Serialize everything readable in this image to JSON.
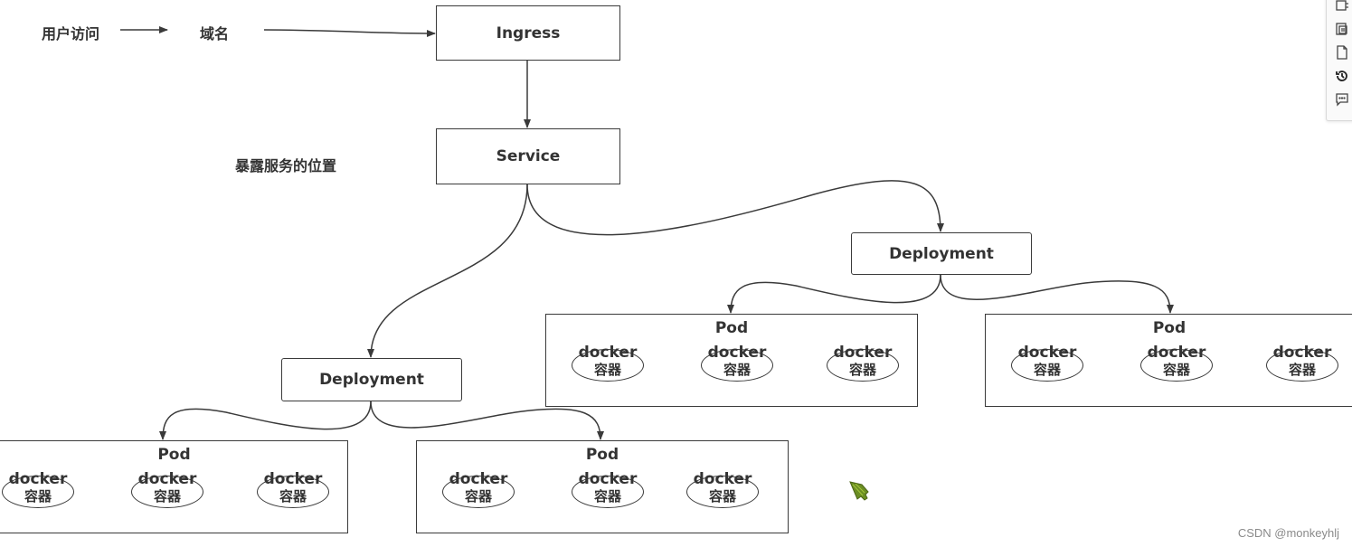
{
  "flow_labels": {
    "user_access": "用户访问",
    "domain": "域名",
    "expose_position": "暴露服务的位置"
  },
  "nodes": {
    "ingress": "Ingress",
    "service": "Service",
    "deployment_left": "Deployment",
    "deployment_right": "Deployment"
  },
  "pods": [
    {
      "title": "Pod",
      "containers": [
        {
          "name": "docker",
          "label": "容器"
        },
        {
          "name": "docker",
          "label": "容器"
        },
        {
          "name": "docker",
          "label": "容器"
        }
      ]
    },
    {
      "title": "Pod",
      "containers": [
        {
          "name": "docker",
          "label": "容器"
        },
        {
          "name": "docker",
          "label": "容器"
        },
        {
          "name": "docker",
          "label": "容器"
        }
      ]
    },
    {
      "title": "Pod",
      "containers": [
        {
          "name": "docker",
          "label": "容器"
        },
        {
          "name": "docker",
          "label": "容器"
        },
        {
          "name": "docker",
          "label": "容器"
        }
      ]
    },
    {
      "title": "Pod",
      "containers": [
        {
          "name": "docker",
          "label": "容器"
        },
        {
          "name": "docker",
          "label": "容器"
        },
        {
          "name": "docker",
          "label": "容器"
        }
      ]
    }
  ],
  "toolbar": {
    "icons": [
      "crop-icon",
      "copy-icon",
      "file-icon",
      "history-icon",
      "comment-icon"
    ]
  },
  "watermark": "CSDN @monkeyhlj",
  "colors": {
    "stroke": "#3a3a3a",
    "text": "#333333",
    "cursor": "#6b8e23"
  }
}
